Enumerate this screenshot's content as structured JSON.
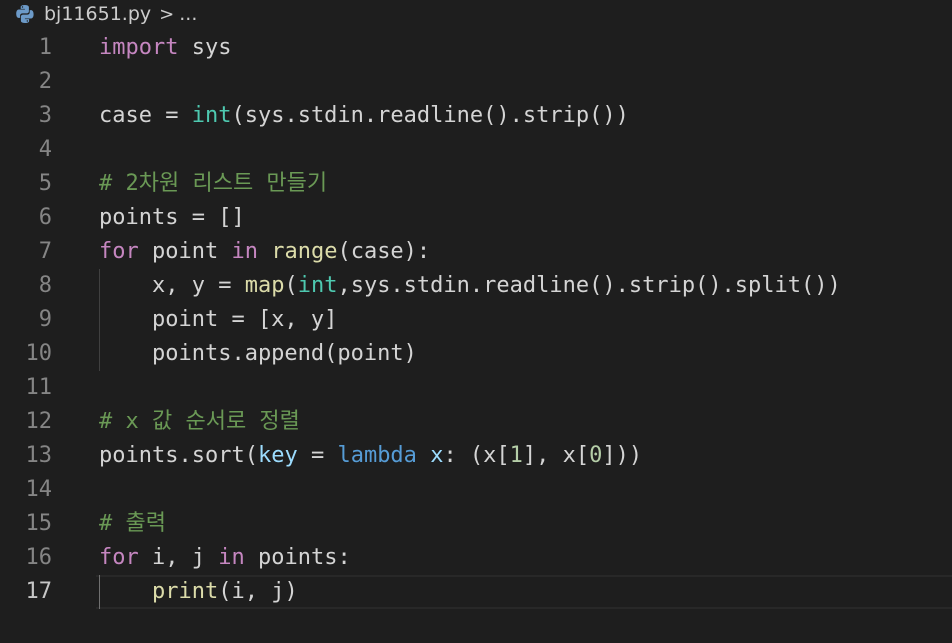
{
  "breadcrumb": {
    "filename": "bj11651.py",
    "separator": ">",
    "ellipsis": "...",
    "icon": "python-icon"
  },
  "colors": {
    "background": "#1e1e1e",
    "keyword": "#c586c0",
    "builtin": "#4ec9b0",
    "function": "#dcdcaa",
    "comment": "#6a9955",
    "number": "#b5cea8",
    "lambda": "#569cd6",
    "parameter": "#9cdcfe",
    "text": "#d4d4d4",
    "line_number": "#858585"
  },
  "editor": {
    "current_line": "17",
    "lines": [
      {
        "n": "1",
        "tokens": [
          [
            "kw",
            "import"
          ],
          [
            "tx",
            " sys"
          ]
        ]
      },
      {
        "n": "2",
        "tokens": []
      },
      {
        "n": "3",
        "tokens": [
          [
            "tx",
            "case = "
          ],
          [
            "bi",
            "int"
          ],
          [
            "tx",
            "(sys.stdin.readline().strip())"
          ]
        ]
      },
      {
        "n": "4",
        "tokens": []
      },
      {
        "n": "5",
        "tokens": [
          [
            "cm",
            "# 2차원 리스트 만들기"
          ]
        ]
      },
      {
        "n": "6",
        "tokens": [
          [
            "tx",
            "points = []"
          ]
        ]
      },
      {
        "n": "7",
        "tokens": [
          [
            "kw",
            "for"
          ],
          [
            "tx",
            " point "
          ],
          [
            "kw",
            "in"
          ],
          [
            "tx",
            " "
          ],
          [
            "fn",
            "range"
          ],
          [
            "tx",
            "(case):"
          ]
        ]
      },
      {
        "n": "8",
        "tokens": [
          [
            "tx",
            "    x, y = "
          ],
          [
            "fn",
            "map"
          ],
          [
            "tx",
            "("
          ],
          [
            "bi",
            "int"
          ],
          [
            "tx",
            ",sys.stdin.readline().strip().split())"
          ]
        ],
        "guide": true
      },
      {
        "n": "9",
        "tokens": [
          [
            "tx",
            "    point = [x, y]"
          ]
        ],
        "guide": true
      },
      {
        "n": "10",
        "tokens": [
          [
            "tx",
            "    points.append(point)"
          ]
        ],
        "guide": true
      },
      {
        "n": "11",
        "tokens": []
      },
      {
        "n": "12",
        "tokens": [
          [
            "cm",
            "# x 값 순서로 정렬"
          ]
        ]
      },
      {
        "n": "13",
        "tokens": [
          [
            "tx",
            "points.sort("
          ],
          [
            "pr",
            "key"
          ],
          [
            "tx",
            " = "
          ],
          [
            "lb",
            "lambda"
          ],
          [
            "tx",
            " "
          ],
          [
            "pr",
            "x"
          ],
          [
            "tx",
            ": (x["
          ],
          [
            "nm",
            "1"
          ],
          [
            "tx",
            "], x["
          ],
          [
            "nm",
            "0"
          ],
          [
            "tx",
            "]))"
          ]
        ]
      },
      {
        "n": "14",
        "tokens": []
      },
      {
        "n": "15",
        "tokens": [
          [
            "cm",
            "# 출력"
          ]
        ]
      },
      {
        "n": "16",
        "tokens": [
          [
            "kw",
            "for"
          ],
          [
            "tx",
            " i, j "
          ],
          [
            "kw",
            "in"
          ],
          [
            "tx",
            " points:"
          ]
        ]
      },
      {
        "n": "17",
        "tokens": [
          [
            "tx",
            "    "
          ],
          [
            "fn",
            "print"
          ],
          [
            "tx",
            "(i, j)"
          ]
        ],
        "guide": true,
        "activeGuide": true,
        "current": true
      }
    ]
  }
}
